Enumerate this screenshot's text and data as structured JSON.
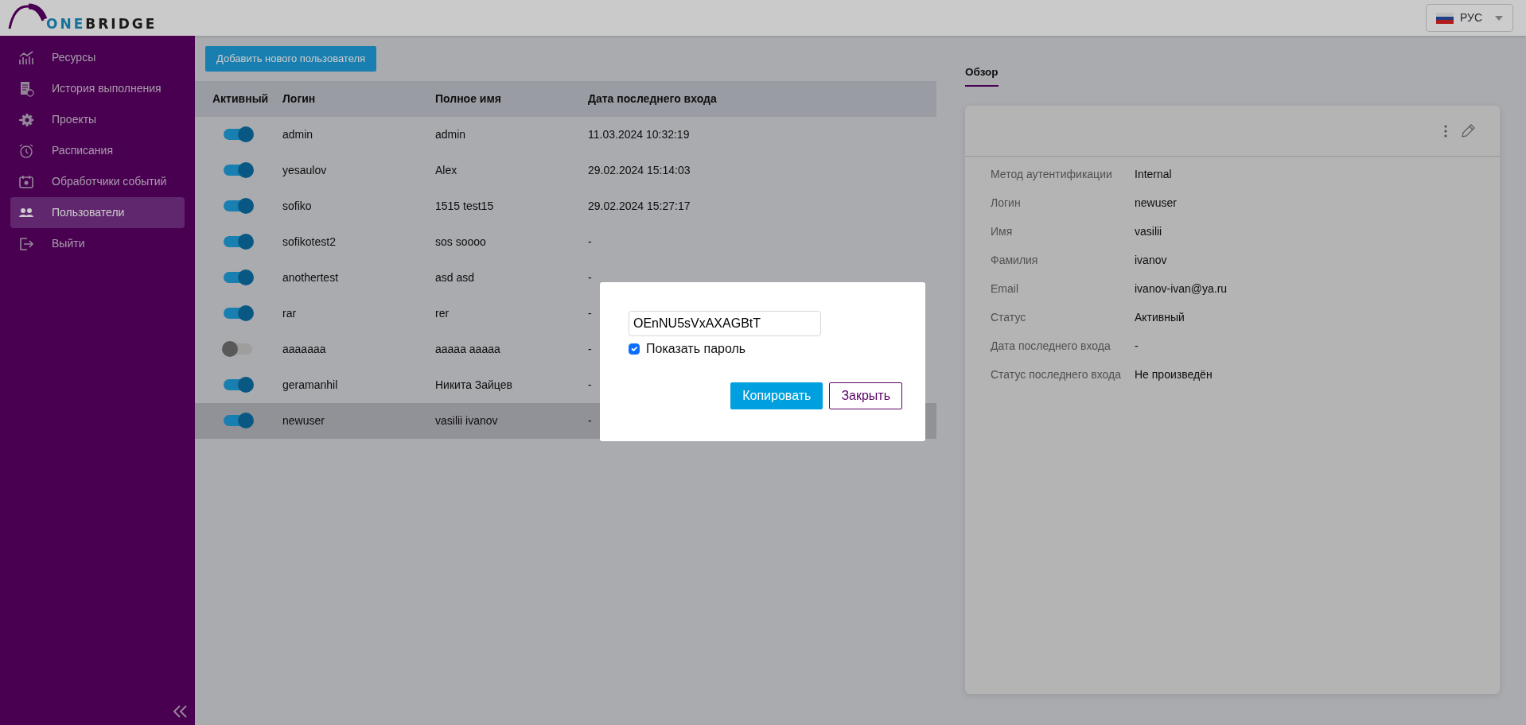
{
  "header": {
    "logo": {
      "parts": [
        "ONE",
        "BRIDGE"
      ]
    },
    "language": {
      "label": "РУС"
    }
  },
  "sidebar": {
    "items": [
      {
        "label": "Ресурсы",
        "selected": false
      },
      {
        "label": "История выполнения",
        "selected": false
      },
      {
        "label": "Проекты",
        "selected": false
      },
      {
        "label": "Расписания",
        "selected": false
      },
      {
        "label": "Обработчики событий",
        "selected": false
      },
      {
        "label": "Пользователи",
        "selected": true
      },
      {
        "label": "Выйти",
        "selected": false
      }
    ]
  },
  "add_button": "Добавить нового пользователя",
  "table": {
    "columns": [
      "Активный",
      "Логин",
      "Полное имя",
      "Дата последнего входа"
    ],
    "rows": [
      {
        "active": true,
        "login": "admin",
        "full_name": "admin",
        "last_login": "11.03.2024 10:32:19",
        "selected": false
      },
      {
        "active": true,
        "login": "yesaulov",
        "full_name": "Alex",
        "last_login": "29.02.2024 15:14:03",
        "selected": false
      },
      {
        "active": true,
        "login": "sofiko",
        "full_name": "1515 test15",
        "last_login": "29.02.2024 15:27:17",
        "selected": false
      },
      {
        "active": true,
        "login": "sofikotest2",
        "full_name": "sos soooo",
        "last_login": "-",
        "selected": false
      },
      {
        "active": true,
        "login": "anothertest",
        "full_name": "asd asd",
        "last_login": "-",
        "selected": false
      },
      {
        "active": true,
        "login": "rar",
        "full_name": "rer",
        "last_login": "-",
        "selected": false
      },
      {
        "active": false,
        "login": "aaaaaaa",
        "full_name": "aaaaa aaaaa",
        "last_login": "-",
        "selected": false
      },
      {
        "active": true,
        "login": "geramanhil",
        "full_name": "Никита Зайцев",
        "last_login": "-",
        "selected": false
      },
      {
        "active": true,
        "login": "newuser",
        "full_name": "vasilii ivanov",
        "last_login": "-",
        "selected": true
      }
    ]
  },
  "details": {
    "tabs": [
      {
        "label": "Обзор",
        "selected": true
      }
    ],
    "fields": [
      {
        "label": "Метод аутентификации",
        "value": "Internal"
      },
      {
        "label": "Логин",
        "value": "newuser"
      },
      {
        "label": "Имя",
        "value": "vasilii"
      },
      {
        "label": "Фамилия",
        "value": "ivanov"
      },
      {
        "label": "Email",
        "value": "ivanov-ivan@ya.ru"
      },
      {
        "label": "Статус",
        "value": "Активный"
      },
      {
        "label": "Дата последнего входа",
        "value": "-"
      },
      {
        "label": "Статус последнего входа",
        "value": "Не произведён"
      }
    ]
  },
  "modal": {
    "password": "OEnNU5sVxAXAGBtT",
    "show_password": {
      "label": "Показать пароль",
      "checked": true
    },
    "buttons": [
      {
        "label": "Копировать",
        "kind": "primary"
      },
      {
        "label": "Закрыть",
        "kind": "outline"
      }
    ]
  }
}
